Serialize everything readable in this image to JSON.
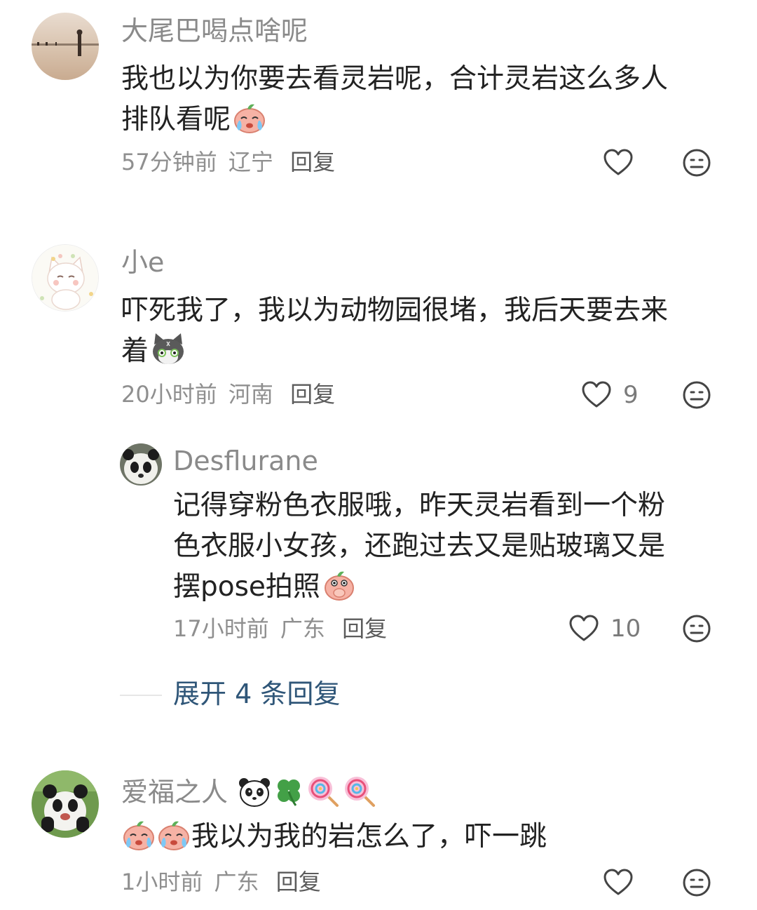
{
  "comments": [
    {
      "username": "大尾巴喝点啥呢",
      "text_line1": "我也以为你要去看灵岩呢，合计灵岩这么多人",
      "text_line2": "排队看呢",
      "time": "57分钟前",
      "location": "辽宁",
      "reply_label": "回复",
      "likes": ""
    },
    {
      "username": "小e",
      "text_line1": "吓死我了，我以为动物园很堵，我后天要去来",
      "text_line2": "着",
      "time": "20小时前",
      "location": "河南",
      "reply_label": "回复",
      "likes": "9",
      "sub_reply": {
        "username": "Desflurane",
        "text_line1": "记得穿粉色衣服哦，昨天灵岩看到一个粉",
        "text_line2": "色衣服小女孩，还跑过去又是贴玻璃又是",
        "text_line3": "摆pose拍照",
        "time": "17小时前",
        "location": "广东",
        "reply_label": "回复",
        "likes": "10"
      },
      "expand_label": "展开 4 条回复"
    },
    {
      "username": "爱福之人",
      "text": "我以为我的岩怎么了，吓一跳",
      "time": "1小时前",
      "location": "广东",
      "reply_label": "回复",
      "likes": ""
    }
  ],
  "icons": {
    "like": "heart-outline-icon",
    "dislike": "meh-face-icon",
    "emoji_cry": "crying-peach-emoji",
    "emoji_cat": "gray-cat-emoji",
    "emoji_shy": "shy-peach-emoji",
    "emoji_panda": "panda-emoji",
    "emoji_clover": "four-leaf-clover-emoji",
    "emoji_lollipop": "lollipop-emoji"
  },
  "colors": {
    "name": "#8a8a8a",
    "text": "#222222",
    "meta": "#8f8f8f",
    "expand": "#2f5678"
  }
}
